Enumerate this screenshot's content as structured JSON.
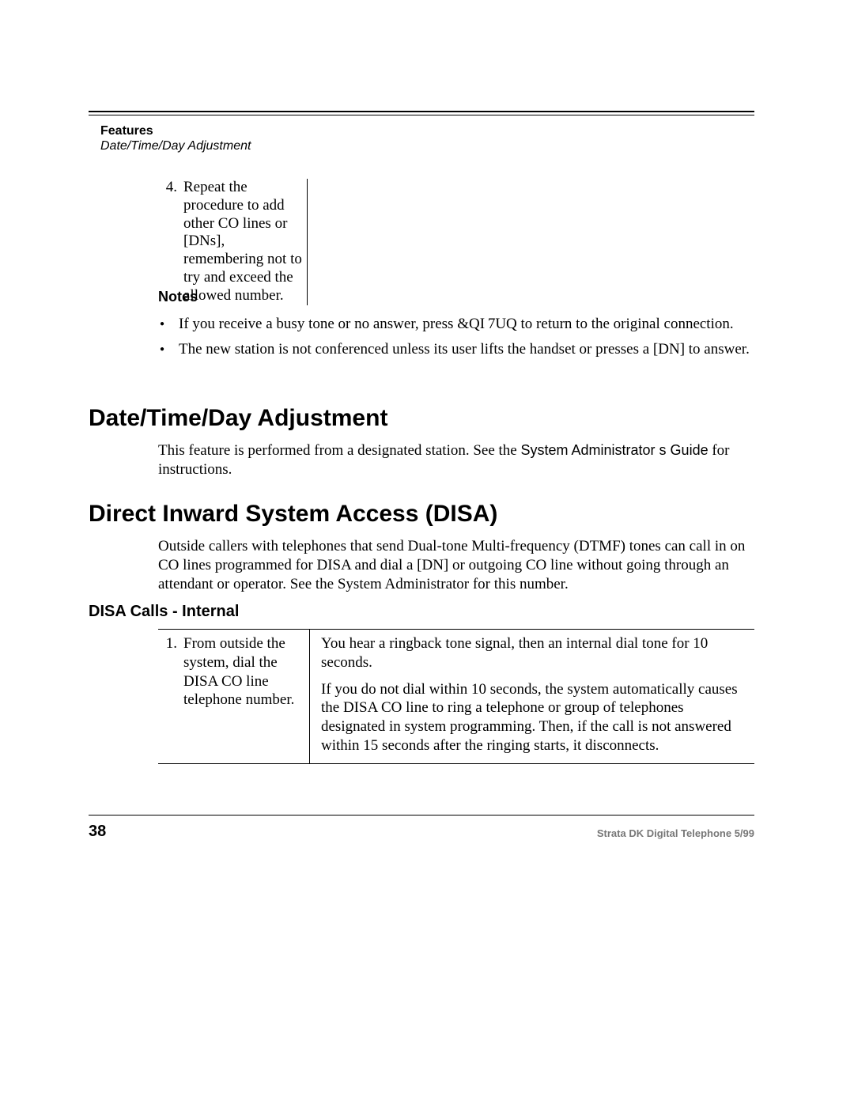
{
  "header": {
    "features": "Features",
    "breadcrumb": "Date/Time/Day Adjustment"
  },
  "step4": {
    "num": "4.",
    "text": "Repeat the procedure to add other CO lines or [DNs], remembering not to try and exceed the allowed number."
  },
  "notes": {
    "heading": "Notes",
    "items": [
      "If you receive a busy tone or no answer, press &QI 7UQ to return to the original connection.",
      "The new station is not conferenced unless its user lifts the handset or presses a [DN] to answer."
    ]
  },
  "datetime": {
    "heading": "Date/Time/Day Adjustment",
    "body_pre": "This feature is performed from a designated station. See the ",
    "body_guide": "System Administrator s Guide",
    "body_mid": " for",
    "body_post": "instructions."
  },
  "disa": {
    "heading": "Direct Inward System Access (DISA)",
    "body": "Outside callers with telephones that send Dual-tone Multi-frequency (DTMF) tones can call in on CO lines programmed for DISA and dial a [DN] or outgoing CO line without going through an attendant or operator. See the System Administrator for this number.",
    "sub_heading": "DISA Calls - Internal",
    "table": {
      "left_num": "1.",
      "left_text": "From outside the system, dial the DISA CO line telephone number.",
      "right_p1": "You hear a ringback tone signal, then an internal dial tone for 10 seconds.",
      "right_p2": "If you do not dial within 10 seconds, the system automatically causes the DISA CO line to ring a telephone or group of telephones designated in system programming. Then, if the call is not answered within 15 seconds after the ringing starts, it disconnects."
    }
  },
  "footer": {
    "page": "38",
    "doc": "Strata DK Digital Telephone   5/99"
  }
}
